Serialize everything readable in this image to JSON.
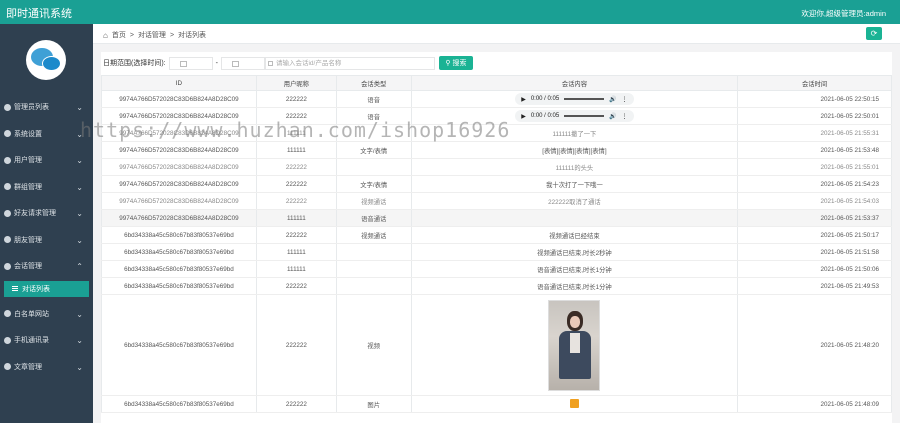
{
  "app": {
    "title": "即时通讯系统",
    "welcome": "欢迎你,超级管理员:admin"
  },
  "sidebar": {
    "items": [
      {
        "label": "管理员列表"
      },
      {
        "label": "系统设置"
      },
      {
        "label": "用户管理"
      },
      {
        "label": "群组管理"
      },
      {
        "label": "好友请求管理"
      },
      {
        "label": "朋友管理"
      },
      {
        "label": "会话管理"
      },
      {
        "label": "白名单网站"
      },
      {
        "label": "手机通讯录"
      },
      {
        "label": "文章管理"
      }
    ],
    "active_sub": "对话列表"
  },
  "breadcrumb": {
    "home": "首页",
    "level1": "对话管理",
    "level2": "对话列表",
    "sep": ">"
  },
  "search": {
    "label": "日期范围(选择时间):",
    "dash": "-",
    "placeholder": "请输入会话id/产品名称",
    "button": "搜索"
  },
  "table": {
    "headers": [
      "ID",
      "用户昵称",
      "会话类型",
      "会话内容",
      "会话时间"
    ],
    "rows": [
      {
        "id": "9974A766D572028C83D6B824A8D28C09",
        "nick": "222222",
        "type": "语音",
        "content": "",
        "audio": true,
        "time": "2021-06-05 22:50:15"
      },
      {
        "id": "9974A766D572028C83D6B824A8D28C09",
        "nick": "222222",
        "type": "语音",
        "content": "",
        "audio": true,
        "time": "2021-06-05 22:50:01"
      },
      {
        "id": "9974A766D572028C83D6B824A8D28C09",
        "nick": "111111",
        "type": "",
        "content": "111111撤了一下",
        "audio": false,
        "time": "2021-06-05 21:55:31"
      },
      {
        "id": "9974A766D572028C83D6B824A8D28C09",
        "nick": "111111",
        "type": "文字/表情",
        "content": "[表情][表情][表情][表情]",
        "audio": false,
        "time": "2021-06-05 21:53:48"
      },
      {
        "id": "9974A766D572028C83D6B824A8D28C09",
        "nick": "222222",
        "type": "",
        "content": "111111的头头",
        "audio": false,
        "time": "2021-06-05 21:55:01"
      },
      {
        "id": "9974A766D572028C83D6B824A8D28C09",
        "nick": "222222",
        "type": "文字/表情",
        "content": "我十次打了一下哦一",
        "audio": false,
        "time": "2021-06-05 21:54:23"
      },
      {
        "id": "9974A766D572028C83D6B824A8D28C09",
        "nick": "222222",
        "type": "视频通话",
        "content": "222222取消了通话",
        "audio": false,
        "time": "2021-06-05 21:54:03"
      },
      {
        "id": "9974A766D572028C83D6B824A8D28C09",
        "nick": "111111",
        "type": "语音通话",
        "content": "",
        "audio": false,
        "time": "2021-06-05 21:53:37"
      },
      {
        "id": "6bd34338a45c580c67b83f80537e69bd",
        "nick": "222222",
        "type": "视频通话",
        "content": "视频通话已经结束",
        "audio": false,
        "time": "2021-06-05 21:50:17"
      },
      {
        "id": "6bd34338a45c580c67b83f80537e69bd",
        "nick": "111111",
        "type": "",
        "content": "视频通话已结束,时长2秒钟",
        "audio": false,
        "time": "2021-06-05 21:51:58"
      },
      {
        "id": "6bd34338a45c580c67b83f80537e69bd",
        "nick": "111111",
        "type": "",
        "content": "语音通话已结束,时长1分钟",
        "audio": false,
        "time": "2021-06-05 21:50:06"
      },
      {
        "id": "6bd34338a45c580c67b83f80537e69bd",
        "nick": "222222",
        "type": "",
        "content": "语音通话已结束,时长1分钟",
        "audio": false,
        "time": "2021-06-05 21:49:53"
      }
    ],
    "video_row": {
      "id": "6bd34338a45c580c67b83f80537e69bd",
      "nick": "222222",
      "type": "视频",
      "time": "2021-06-05 21:48:20"
    },
    "image_row": {
      "id": "6bd34338a45c580c67b83f80537e69bd",
      "nick": "222222",
      "type": "图片",
      "time": "2021-06-05 21:48:09"
    },
    "audio_time": "0:00 / 0:05"
  },
  "watermark": "https://www.huzhan.com/ishop16926"
}
